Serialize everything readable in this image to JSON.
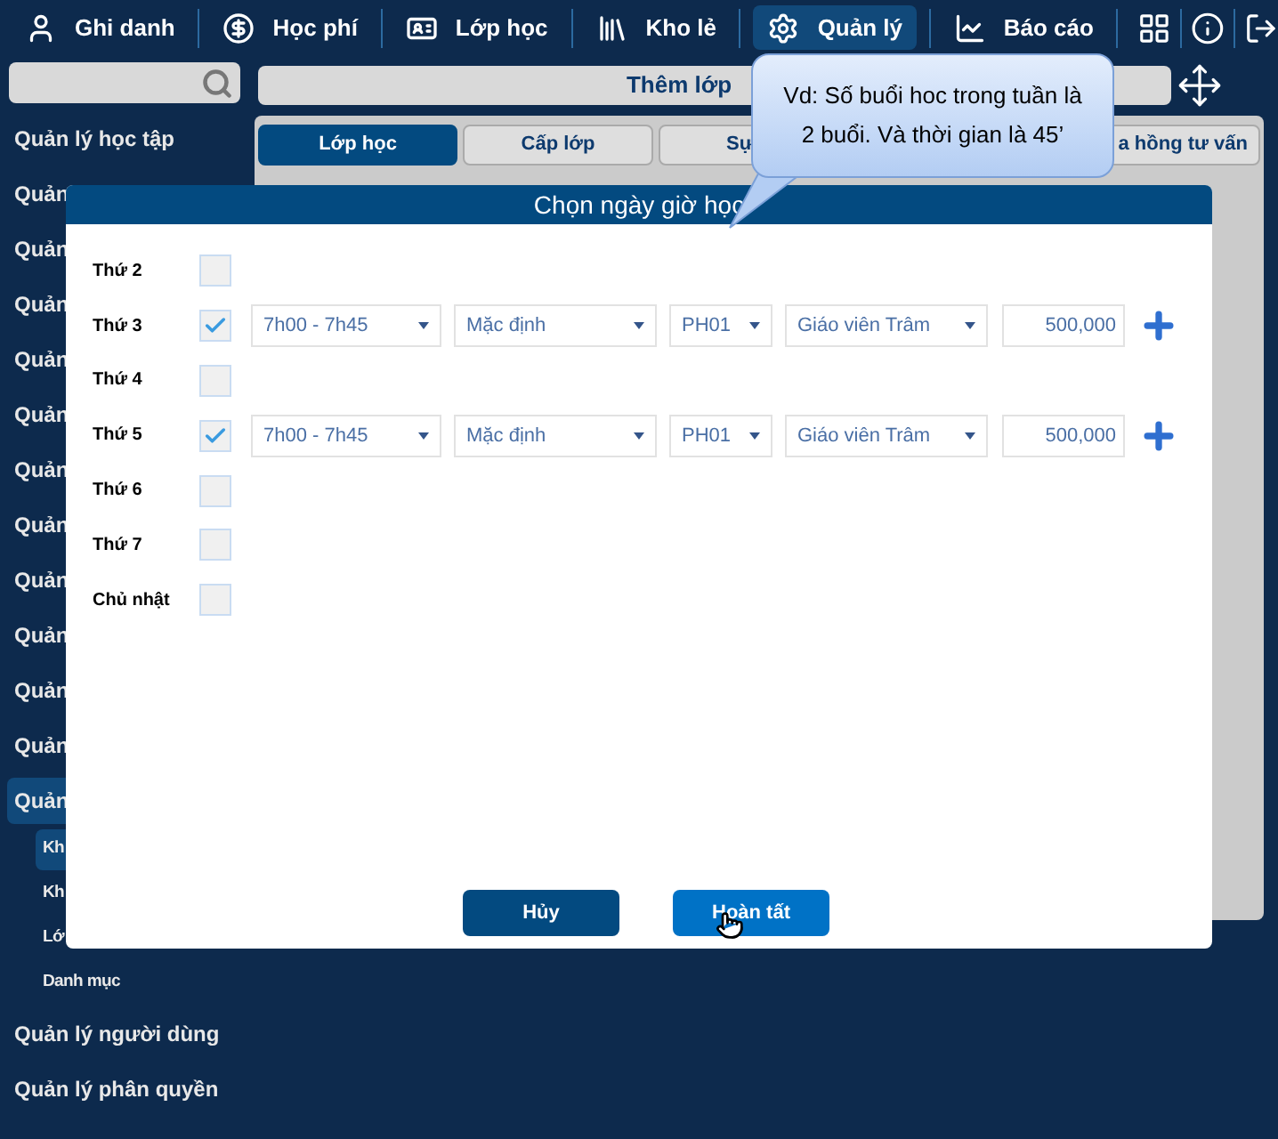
{
  "top_nav": {
    "items": [
      {
        "label": "Ghi danh",
        "selected": false
      },
      {
        "label": "Học phí",
        "selected": false
      },
      {
        "label": "Lớp học",
        "selected": false
      },
      {
        "label": "Kho lẻ",
        "selected": false
      },
      {
        "label": "Quản lý",
        "selected": true
      },
      {
        "label": "Báo cáo",
        "selected": false
      }
    ]
  },
  "sidebar": {
    "items": [
      {
        "label": "Quản lý học tập",
        "selected": false
      },
      {
        "label": "Quản",
        "selected": false
      },
      {
        "label": "Quản",
        "selected": false
      },
      {
        "label": "Quản",
        "selected": false
      },
      {
        "label": "Quản",
        "selected": false
      },
      {
        "label": "Quản",
        "selected": false
      },
      {
        "label": "Quản",
        "selected": false
      },
      {
        "label": "Quản",
        "selected": false
      },
      {
        "label": "Quản",
        "selected": false
      },
      {
        "label": "Quản",
        "selected": false
      },
      {
        "label": "Quản",
        "selected": false
      },
      {
        "label": "Quản",
        "selected": false
      },
      {
        "label": "Quản",
        "selected": true,
        "children": [
          {
            "label": "Kh",
            "selected": true
          },
          {
            "label": "Kh",
            "selected": false
          },
          {
            "label": "Lớ",
            "selected": false
          },
          {
            "label": "Danh mục",
            "selected": false
          }
        ]
      },
      {
        "label": "Quản lý người dùng",
        "selected": false
      },
      {
        "label": "Quản lý phân quyền",
        "selected": false
      }
    ]
  },
  "header": {
    "title": "Thêm lớp"
  },
  "tabs": [
    {
      "label": "Lớp học",
      "selected": true
    },
    {
      "label": "Cấp lớp",
      "selected": false
    },
    {
      "label": "Sự",
      "selected": false
    },
    {
      "label": "a hồng tư vấn",
      "selected": false
    }
  ],
  "dialog": {
    "title": "Chọn ngày giờ học",
    "rows": [
      {
        "day": "Thứ 2",
        "checked": false
      },
      {
        "day": "Thứ 3",
        "checked": true,
        "time": "7h00 - 7h45",
        "room_type": "Mặc định",
        "room": "PH01",
        "teacher": "Giáo viên Trâm",
        "price": "500,000"
      },
      {
        "day": "Thứ 4",
        "checked": false
      },
      {
        "day": "Thứ 5",
        "checked": true,
        "time": "7h00 - 7h45",
        "room_type": "Mặc định",
        "room": "PH01",
        "teacher": "Giáo viên Trâm",
        "price": "500,000"
      },
      {
        "day": "Thứ 6",
        "checked": false
      },
      {
        "day": "Thứ 7",
        "checked": false
      },
      {
        "day": "Chủ nhật",
        "checked": false
      }
    ],
    "buttons": [
      {
        "label": "Hủy",
        "kind": "secondary"
      },
      {
        "label": "Hoàn tất",
        "kind": "primary"
      }
    ]
  },
  "callout": {
    "lines": [
      "Vd: Số buổi hoc trong tuần là",
      "2 buổi. Và thời gian là 45’"
    ]
  }
}
